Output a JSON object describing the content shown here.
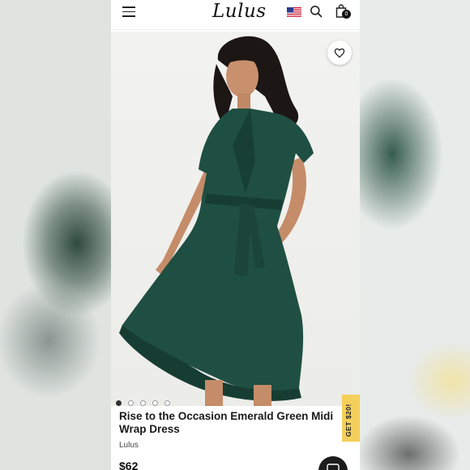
{
  "header": {
    "logo_text": "Lulus",
    "cart_count": "0",
    "menu_icon": "hamburger-menu-icon",
    "flag_icon": "us-flag-icon",
    "search_icon": "search-icon",
    "bag_icon": "shopping-bag-icon"
  },
  "gallery": {
    "image_count": 5,
    "active_index": 0,
    "dress_color": "#1f4f42",
    "favorite_icon": "heart-outline-icon"
  },
  "product": {
    "title": "Rise to the Occasion Emerald Green Midi Wrap Dress",
    "brand": "Lulus",
    "price": "$62"
  },
  "promo": {
    "label": "GET $20!",
    "color": "#f4cf5a"
  },
  "chat": {
    "icon": "chat-bubble-icon"
  }
}
